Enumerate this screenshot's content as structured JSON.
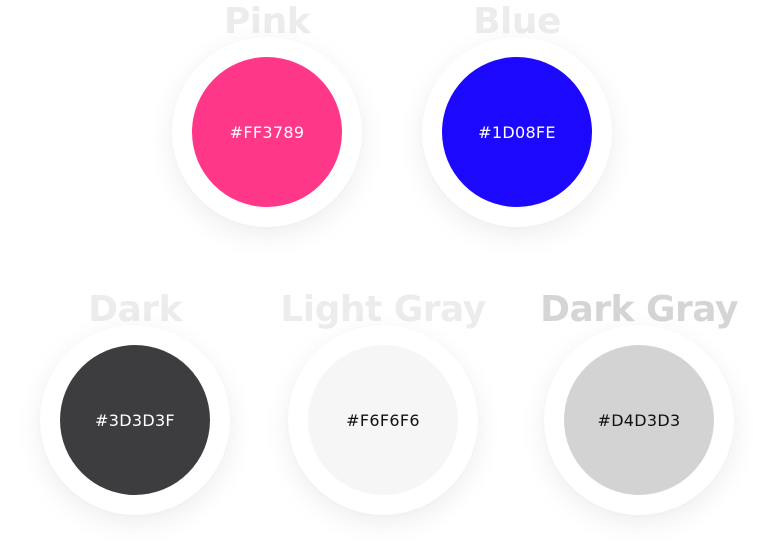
{
  "swatches": [
    {
      "key": "pink",
      "name": "Pink",
      "hex": "#FF3789",
      "text_color": "#ffffff"
    },
    {
      "key": "blue",
      "name": "Blue",
      "hex": "#1D08FE",
      "text_color": "#ffffff"
    },
    {
      "key": "dark",
      "name": "Dark",
      "hex": "#3D3D3F",
      "text_color": "#ffffff"
    },
    {
      "key": "light-gray",
      "name": "Light Gray",
      "hex": "#F6F6F6",
      "text_color": "#111111"
    },
    {
      "key": "dark-gray",
      "name": "Dark Gray",
      "hex": "#D4D3D3",
      "text_color": "#111111"
    }
  ]
}
